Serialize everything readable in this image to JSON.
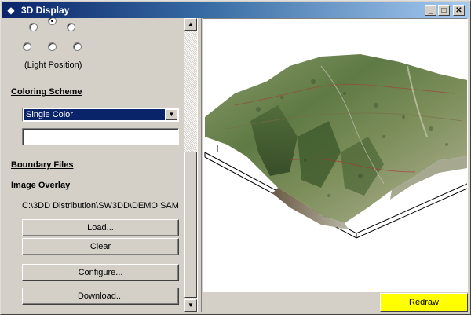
{
  "window": {
    "title": "3D Display",
    "minimize_glyph": "_",
    "maximize_glyph": "□",
    "close_glyph": "✕"
  },
  "light_position": {
    "label": "(Light Position)",
    "selected": "top-center"
  },
  "coloring_scheme": {
    "heading": "Coloring Scheme",
    "selected_value": "Single Color",
    "color_field_value": ""
  },
  "boundary_files": {
    "heading": "Boundary Files"
  },
  "image_overlay": {
    "heading": "Image Overlay",
    "path": "C:\\3DD Distribution\\SW3DD\\DEMO SAM",
    "load_label": "Load...",
    "clear_label": "Clear",
    "configure_label": "Configure...",
    "download_label": "Download..."
  },
  "redraw_label": "Redraw",
  "icons": {
    "app": "app-icon",
    "scroll_up": "arrow-up-icon",
    "scroll_down": "arrow-down-icon",
    "dropdown": "chevron-down-icon"
  },
  "colors": {
    "title_start": "#0a246a",
    "title_end": "#a6caf0",
    "redraw_bg": "#ffff00",
    "selection": "#0a246a"
  }
}
